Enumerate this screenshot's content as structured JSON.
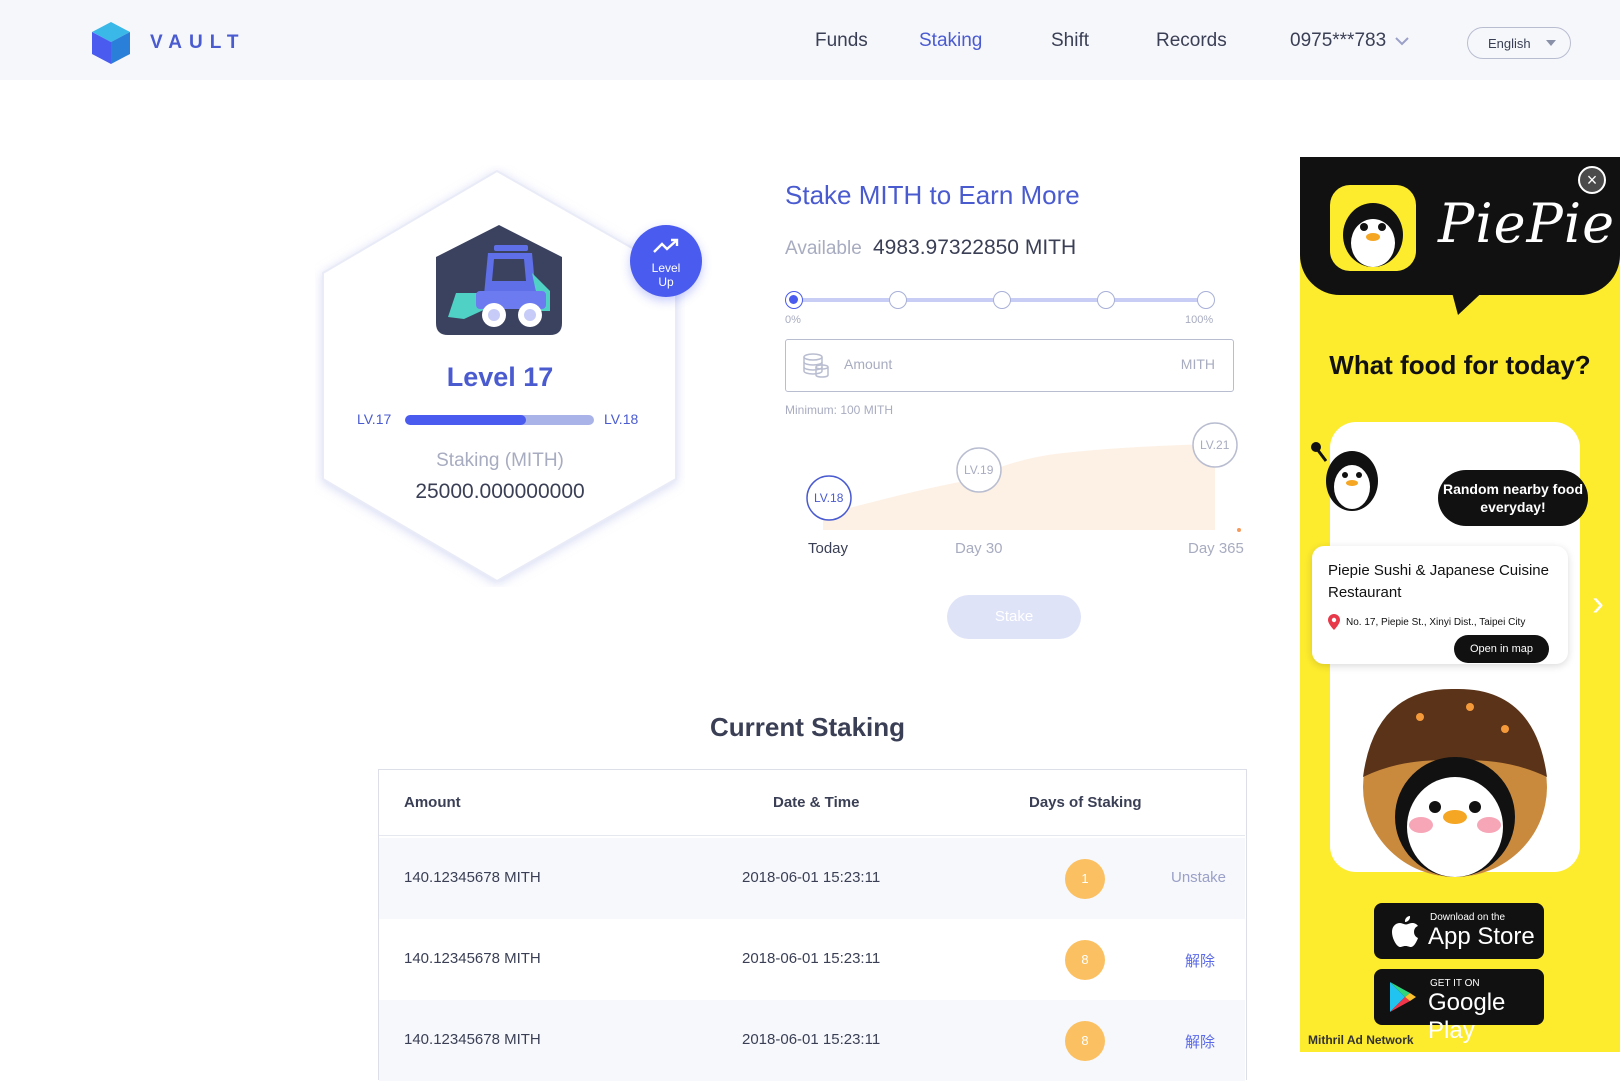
{
  "header": {
    "brand": "VAULT",
    "nav": [
      {
        "label": "Funds",
        "active": false
      },
      {
        "label": "Staking",
        "active": true
      },
      {
        "label": "Shift",
        "active": false
      },
      {
        "label": "Records",
        "active": false
      }
    ],
    "account": "0975***783",
    "language": "English"
  },
  "level_card": {
    "level_up": "Level Up",
    "title": "Level 17",
    "current_lv": "LV.17",
    "next_lv": "LV.18",
    "progress_fraction": 0.64,
    "staking_label": "Staking (MITH)",
    "staking_value": "25000.000000000"
  },
  "stake_form": {
    "title": "Stake MITH to Earn More",
    "available_label": "Available",
    "available_value": "4983.97322850 MITH",
    "slider_min_label": "0%",
    "slider_max_label": "100%",
    "slider_selected_index": 0,
    "amount_placeholder": "Amount",
    "amount_unit": "MITH",
    "minimum_text": "Minimum: 100 MITH",
    "projection": {
      "levels": [
        "LV.18",
        "LV.19",
        "LV.21"
      ],
      "labels": [
        "Today",
        "Day 30",
        "Day 365"
      ]
    },
    "stake_button": "Stake"
  },
  "current_staking": {
    "title": "Current Staking",
    "columns": [
      "Amount",
      "Date & Time",
      "Days of Staking"
    ],
    "rows": [
      {
        "amount": "140.12345678 MITH",
        "datetime": "2018-06-01 15:23:11",
        "days": "1",
        "action": "Unstake"
      },
      {
        "amount": "140.12345678 MITH",
        "datetime": "2018-06-01 15:23:11",
        "days": "8",
        "action": "解除"
      },
      {
        "amount": "140.12345678 MITH",
        "datetime": "2018-06-01 15:23:11",
        "days": "8",
        "action": "解除"
      }
    ]
  },
  "ad": {
    "brand": "PiePie",
    "headline": "What food for today?",
    "bubble": "Random nearby food everyday!",
    "card_title": "Piepie Sushi & Japanese Cuisine Restaurant",
    "card_address": "No. 17, Piepie St., Xinyi Dist., Taipei City",
    "open_map": "Open in map",
    "app_store_small": "Download on the",
    "app_store_big": "App Store",
    "google_small": "GET IT ON",
    "google_big": "Google Play",
    "network": "Mithril Ad Network",
    "close": "×"
  },
  "colors": {
    "accent": "#4a5bf0",
    "badge": "#fbc061",
    "ad_yellow": "#fdeb2e"
  }
}
